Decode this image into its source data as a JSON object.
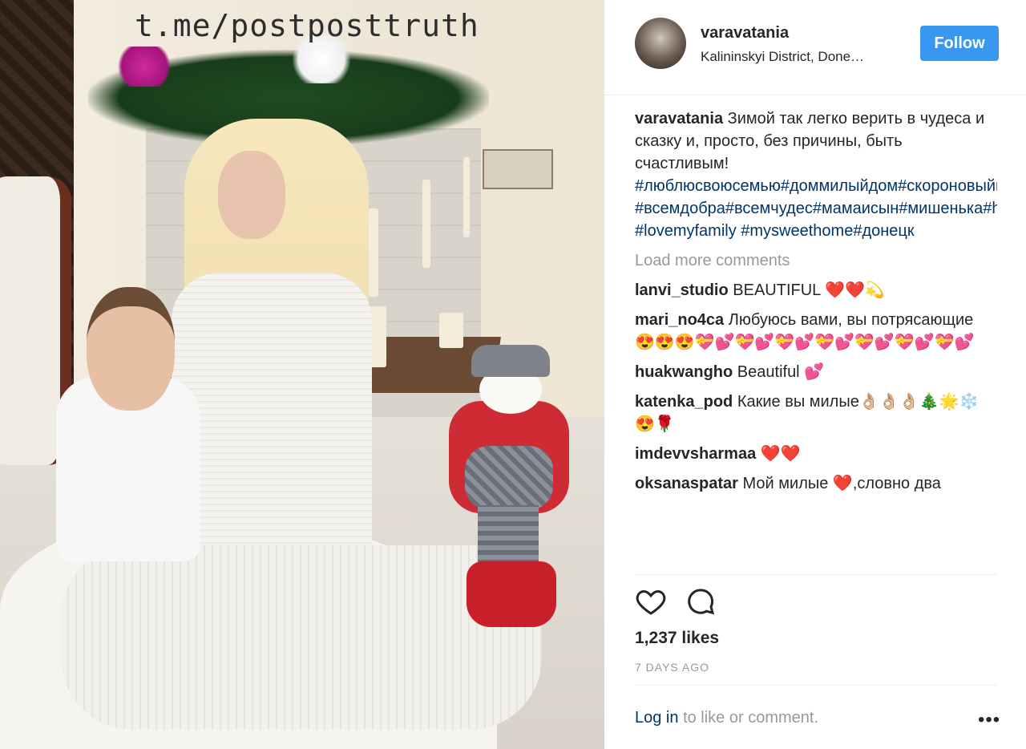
{
  "watermark": "t.me/postposttruth",
  "header": {
    "username": "varavatania",
    "location": "Kalininskyi District, Done…",
    "follow_label": "Follow"
  },
  "caption": {
    "username": "varavatania",
    "text": "Зимой так легко верить в чудеса и сказку и, просто, без причины, быть счастливым!",
    "hashtags": "#люблюсвоюсемью#доммилыйдом#скороновыйгод#домаутаниvarava #всемдобра#всемчудес#мамаисын#мишенька#happymom #lovemyfamily #mysweethome#донецк"
  },
  "load_more": "Load more comments",
  "comments": [
    {
      "username": "lanvi_studio",
      "text": "BEAUTIFUL ❤️❤️💫"
    },
    {
      "username": "mari_no4ca",
      "text": "Любуюсь вами, вы потрясающие 😍😍😍💝💕💝💕💝💕💝💕💝💕💝💕💝💕"
    },
    {
      "username": "huakwangho",
      "text": "Beautiful 💕"
    },
    {
      "username": "katenka_pod",
      "text": "Какие вы милые👌🏼👌🏼👌🏼🎄🌟❄️😍🌹"
    },
    {
      "username": "imdevvsharmaa",
      "text": "❤️❤️"
    },
    {
      "username": "oksanaspatar",
      "text": "Мой милые ❤️,словно два"
    }
  ],
  "actions": {
    "like_icon": "heart-icon",
    "comment_icon": "comment-bubble-icon"
  },
  "likes": "1,237 likes",
  "time_ago": "7 DAYS AGO",
  "footer": {
    "login_label": "Log in",
    "rest_text": "to like or comment.",
    "more_label": "•••"
  },
  "colors": {
    "follow_bg": "#3897f0",
    "hashtag": "#003569",
    "muted": "#999999",
    "text": "#262626"
  }
}
